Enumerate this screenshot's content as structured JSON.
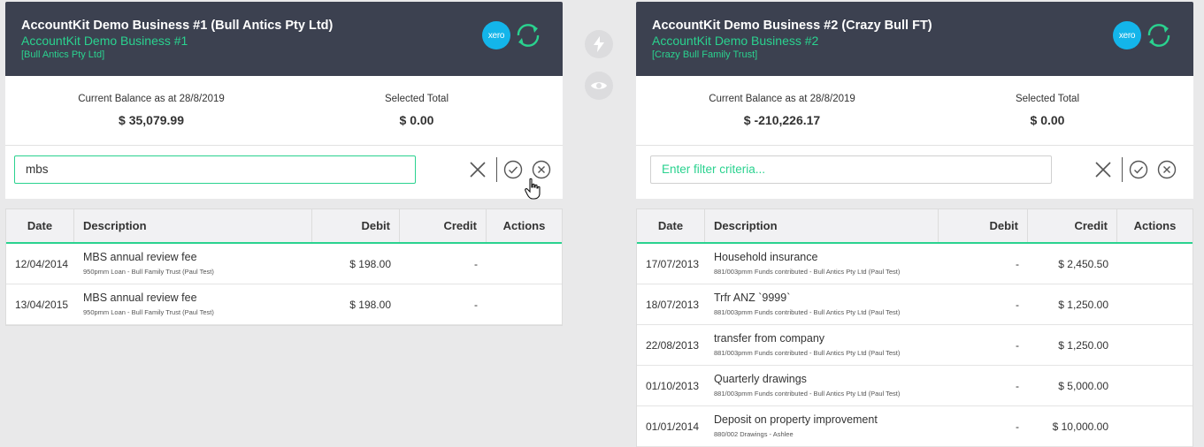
{
  "left": {
    "title": "AccountKit Demo Business #1 (Bull Antics Pty Ltd)",
    "subtitle": "AccountKit Demo Business #1",
    "entity": "[Bull Antics Pty Ltd]",
    "xero_label": "xero",
    "balance_label": "Current Balance as at 28/8/2019",
    "balance_value": "$ 35,079.99",
    "selected_label": "Selected Total",
    "selected_value": "$ 0.00",
    "filter_value": "mbs",
    "columns": [
      "Date",
      "Description",
      "Debit",
      "Credit",
      "Actions"
    ],
    "rows": [
      {
        "date": "12/04/2014",
        "desc": "MBS annual review fee",
        "sub": "950pmm Loan - Bull Family Trust (Paul Test)",
        "debit": "$ 198.00",
        "credit": "-"
      },
      {
        "date": "13/04/2015",
        "desc": "MBS annual review fee",
        "sub": "950pmm Loan - Bull Family Trust (Paul Test)",
        "debit": "$ 198.00",
        "credit": "-"
      }
    ]
  },
  "right": {
    "title": "AccountKit Demo Business #2 (Crazy Bull FT)",
    "subtitle": "AccountKit Demo Business #2",
    "entity": "[Crazy Bull Family Trust]",
    "xero_label": "xero",
    "balance_label": "Current Balance as at 28/8/2019",
    "balance_value": "$ -210,226.17",
    "selected_label": "Selected Total",
    "selected_value": "$ 0.00",
    "filter_placeholder": "Enter filter criteria...",
    "columns": [
      "Date",
      "Description",
      "Debit",
      "Credit",
      "Actions"
    ],
    "rows": [
      {
        "date": "17/07/2013",
        "desc": "Household insurance",
        "sub": "881/003pmm Funds contributed - Bull Antics Pty Ltd (Paul Test)",
        "debit": "-",
        "credit": "$ 2,450.50"
      },
      {
        "date": "18/07/2013",
        "desc": "Trfr ANZ `9999`",
        "sub": "881/003pmm Funds contributed - Bull Antics Pty Ltd (Paul Test)",
        "debit": "-",
        "credit": "$ 1,250.00"
      },
      {
        "date": "22/08/2013",
        "desc": "transfer from company",
        "sub": "881/003pmm Funds contributed - Bull Antics Pty Ltd (Paul Test)",
        "debit": "-",
        "credit": "$ 1,250.00"
      },
      {
        "date": "01/10/2013",
        "desc": "Quarterly drawings",
        "sub": "881/003pmm Funds contributed - Bull Antics Pty Ltd (Paul Test)",
        "debit": "-",
        "credit": "$ 5,000.00"
      },
      {
        "date": "01/01/2014",
        "desc": "Deposit on property improvement",
        "sub": "880/002 Drawings - Ashlee",
        "debit": "-",
        "credit": "$ 10,000.00"
      }
    ]
  },
  "colors": {
    "header_bg": "#3c4150",
    "accent": "#2ad28f",
    "xero": "#13b5ea"
  },
  "icons": [
    "xero-icon",
    "sync-icon",
    "lightning-icon",
    "eye-icon",
    "clear-icon",
    "check-circle-icon",
    "cancel-circle-icon",
    "hand-cursor-icon"
  ]
}
